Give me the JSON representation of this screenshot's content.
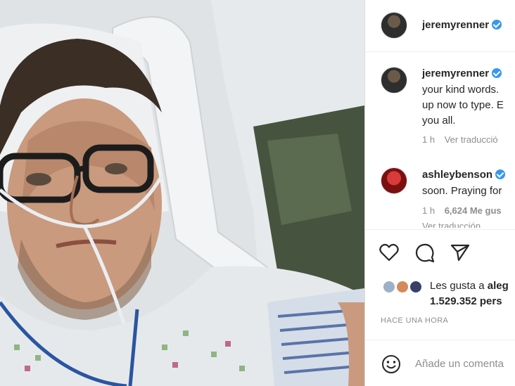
{
  "post": {
    "author": "jeremyrenner",
    "photo_alt": "selfie in hospital bed"
  },
  "comments": [
    {
      "username": "jeremyrenner",
      "lines": [
        "your kind words.",
        "up now to type. E",
        "you all."
      ],
      "time": "1 h",
      "translate": "Ver traducció"
    },
    {
      "username": "ashleybenson",
      "lines": [
        "soon. Praying for"
      ],
      "time": "1 h",
      "likes": "6,624 Me gus",
      "translate": "Ver traducción"
    }
  ],
  "actions": {
    "like_icon": "heart-icon",
    "comment_icon": "comment-icon",
    "share_icon": "send-icon"
  },
  "likes": {
    "prefix": "Les gusta a",
    "name": "aleg",
    "count": "1.529.352 pers"
  },
  "timestamp": "HACE UNA HORA",
  "comment_box": {
    "emoji_icon": "smiley-icon",
    "placeholder": "Añade un comenta"
  },
  "colors": {
    "verified": "#3897f0",
    "secondary_text": "#8e8e8e",
    "border": "#dbdbdb"
  }
}
